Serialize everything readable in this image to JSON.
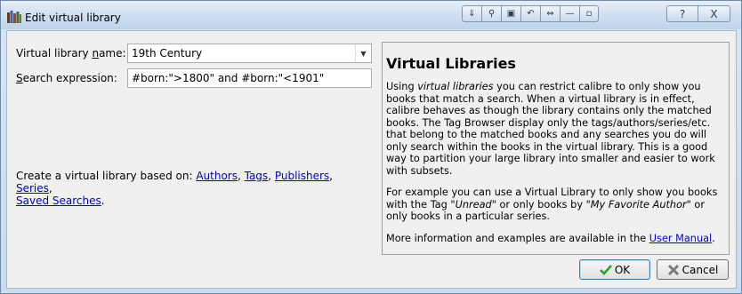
{
  "window": {
    "title": "Edit virtual library",
    "toolbar_icons": [
      "menu-down-icon",
      "pin-icon",
      "roll-up-icon",
      "undo-arrow-icon",
      "resize-icon",
      "minimize-icon",
      "restore-icon"
    ],
    "help_icon": "?",
    "close_icon": "X"
  },
  "form": {
    "name_label": "Virtual library name:",
    "name_mnemonic": "n",
    "name_value": "19th Century",
    "search_label": "Search expression:",
    "search_mnemonic": "S",
    "search_value": "#born:\">1800\" and #born:\"<1901\""
  },
  "create": {
    "prefix": "Create a virtual library based on: ",
    "links": [
      "Authors",
      "Tags",
      "Publishers",
      "Series",
      "Saved Searches"
    ],
    "suffix": "."
  },
  "help_panel": {
    "heading": "Virtual Libraries",
    "p1_before": "Using ",
    "p1_italic": "virtual libraries",
    "p1_after": " you can restrict calibre to only show you books that match a search. When a virtual library is in effect, calibre behaves as though the library contains only the matched books. The Tag Browser display only the tags/authors/series/etc. that belong to the matched books and any searches you do will only search within the books in the virtual library. This is a good way to partition your large library into smaller and easier to work with subsets.",
    "p2_a": "For example you can use a Virtual Library to only show you books with the Tag ",
    "p2_italic1": "\"Unread\"",
    "p2_b": " or only books by ",
    "p2_italic2": "\"My Favorite Author\"",
    "p2_c": " or only books in a particular series.",
    "p3_before": "More information and examples are available in the ",
    "p3_link": "User Manual",
    "p3_after": "."
  },
  "buttons": {
    "ok": "OK",
    "cancel": "Cancel",
    "ok_icon": "checkmark-icon",
    "cancel_icon": "cross-icon"
  },
  "colors": {
    "link": "#0000cc",
    "ok_check": "#2e9e2e",
    "cancel_x": "#7a7a7a"
  }
}
